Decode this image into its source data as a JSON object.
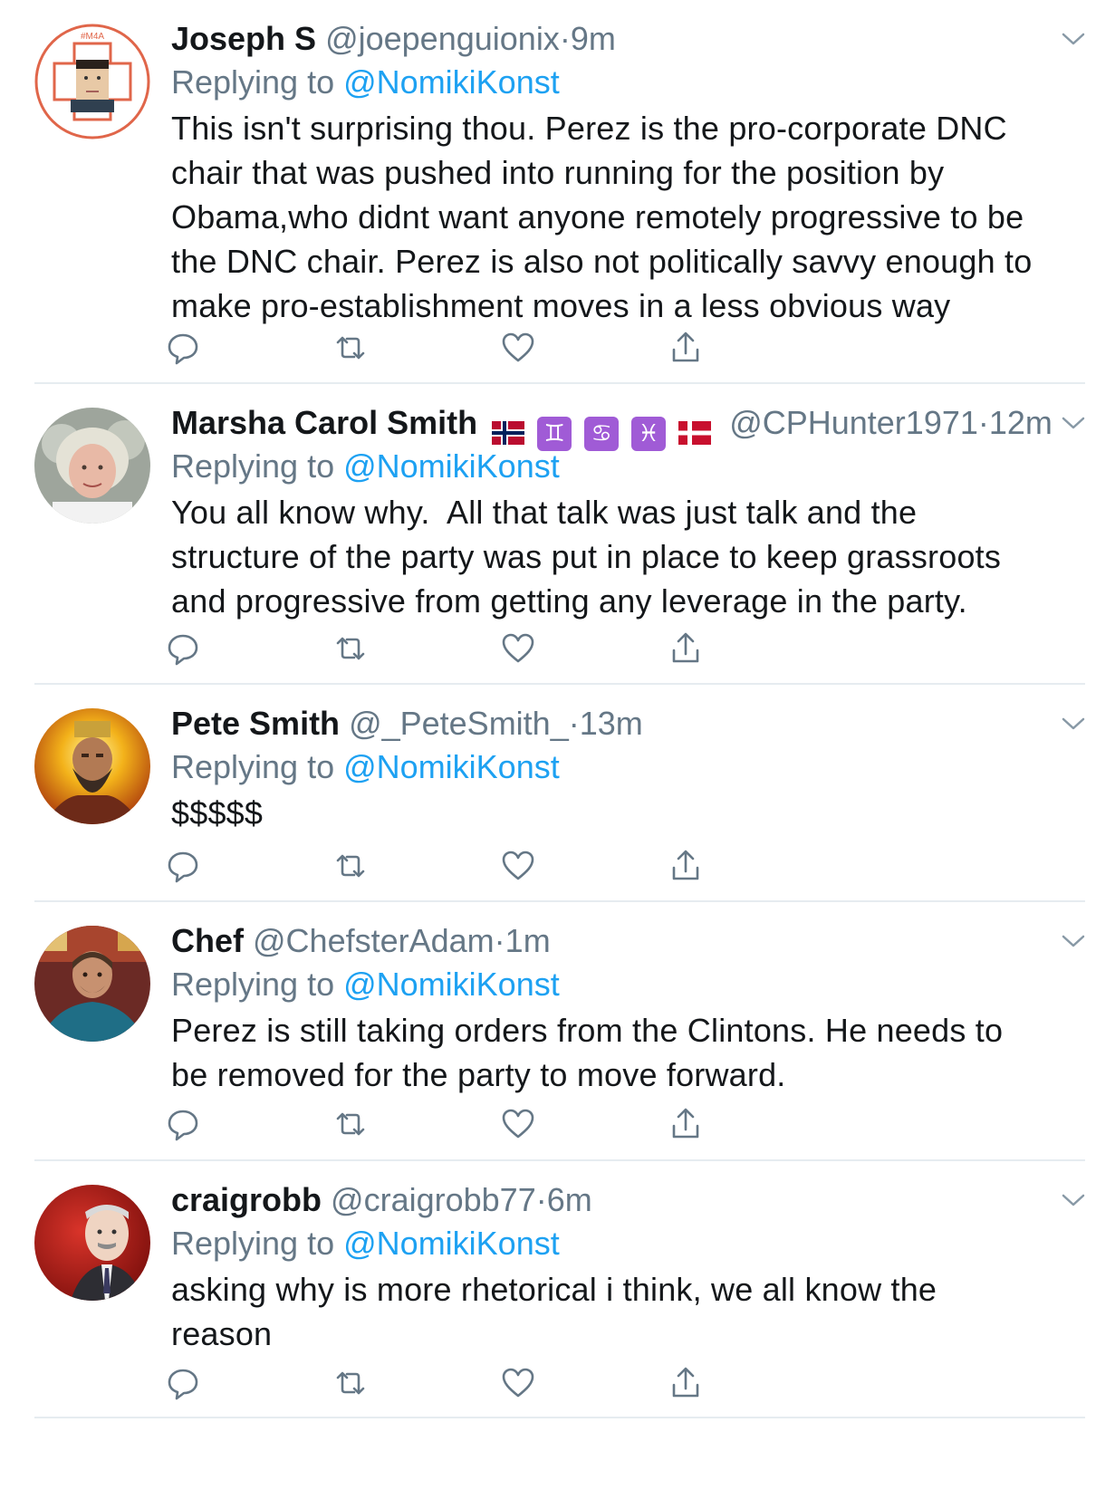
{
  "replying_prefix": "Replying to",
  "tweets": [
    {
      "name": "Joseph S",
      "handle": "@joepenguionix",
      "time": "9m",
      "reply_to": "@NomikiKonst",
      "avatar_badge": "#M4A",
      "lines": [
        "This isn't surprising thou. Perez is the pro-corporate DNC",
        "chair that was pushed into running for the position by",
        "Obama,who didnt want anyone remotely progressive to be",
        "the DNC chair. Perez is also not politically savvy enough to",
        "make pro-establishment moves in a less obvious way"
      ]
    },
    {
      "name": "Marsha Carol Smith",
      "handle": "@CPHunter1971",
      "time": "12m",
      "reply_to": "@NomikiKonst",
      "name_emojis": [
        "norway-flag",
        "gemini-sign",
        "cancer-sign",
        "pisces-sign",
        "denmark-flag"
      ],
      "zodiac_glyphs": [
        "♊",
        "♋",
        "♓"
      ],
      "lines": [
        "You all know why.  All that talk was just talk and the",
        "structure of the party was put in place to keep grassroots",
        "and progressive from getting any leverage in the party."
      ]
    },
    {
      "name": "Pete Smith",
      "handle": "@_PeteSmith_",
      "time": "13m",
      "reply_to": "@NomikiKonst",
      "lines": [
        "$$$$$"
      ]
    },
    {
      "name": "Chef",
      "handle": "@ChefsterAdam",
      "time": "1m",
      "reply_to": "@NomikiKonst",
      "lines": [
        "Perez is still taking orders from the Clintons. He needs to",
        "be removed for the party to move forward."
      ]
    },
    {
      "name": "craigrobb",
      "handle": "@craigrobb77",
      "time": "6m",
      "reply_to": "@NomikiKonst",
      "lines": [
        "asking why is more rhetorical i think, we all know the",
        "reason"
      ]
    }
  ],
  "colors": {
    "name": "#14171a",
    "meta": "#657786",
    "mention": "#1da1f2",
    "divider": "#e6ecf0",
    "icon": "#657786"
  },
  "action_icons": [
    "reply-icon",
    "retweet-icon",
    "like-icon",
    "share-icon"
  ]
}
